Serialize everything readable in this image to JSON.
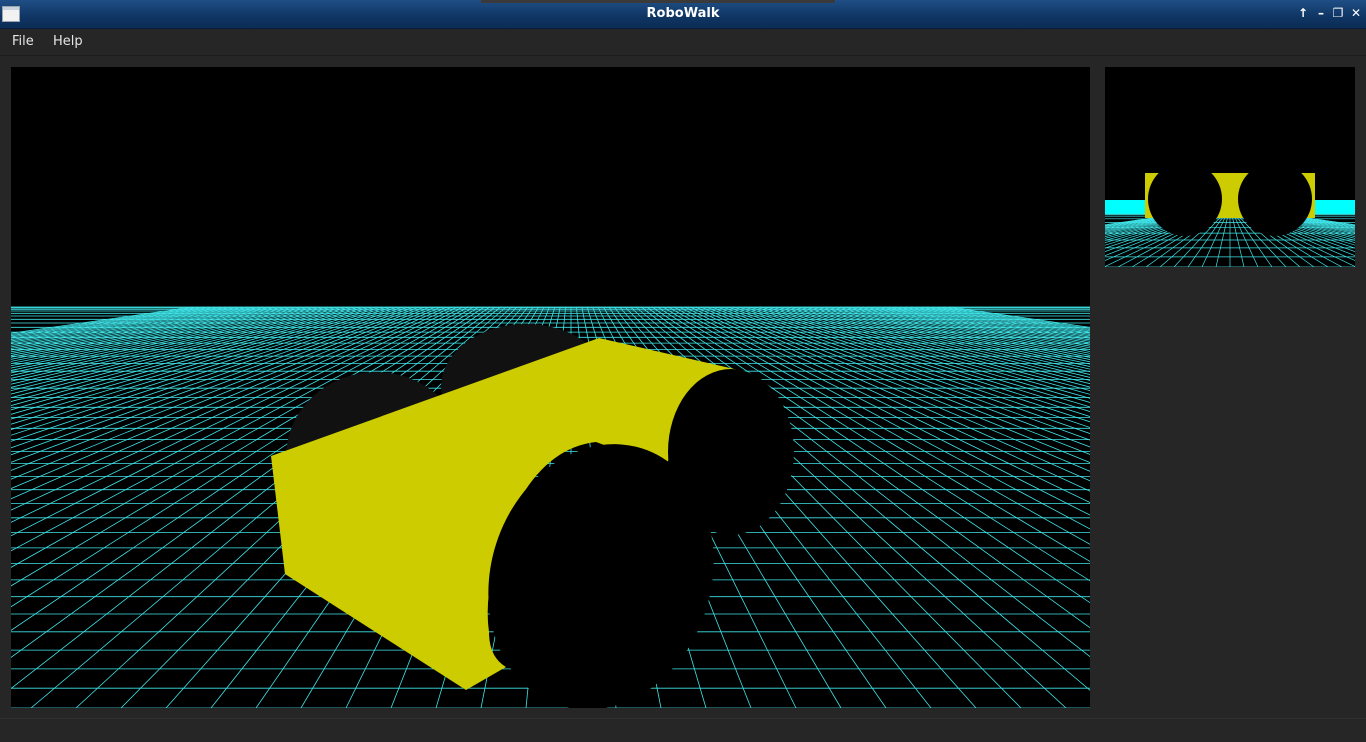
{
  "window": {
    "title": "RoboWalk",
    "controls": [
      "↑",
      "–",
      "❐",
      "✕"
    ]
  },
  "menu": {
    "items": [
      "File",
      "Help"
    ]
  },
  "colors": {
    "grid": "#3fe4e8",
    "robot_body": "#cccc00",
    "wheel": "#000000",
    "background": "#000000",
    "window_bg": "#262626",
    "titlebar": "#123c6d"
  },
  "icons": {
    "window_icon": "app-window-icon",
    "keep_above": "arrow-up-icon",
    "minimize": "minimize-icon",
    "maximize": "maximize-icon",
    "close": "close-icon"
  }
}
